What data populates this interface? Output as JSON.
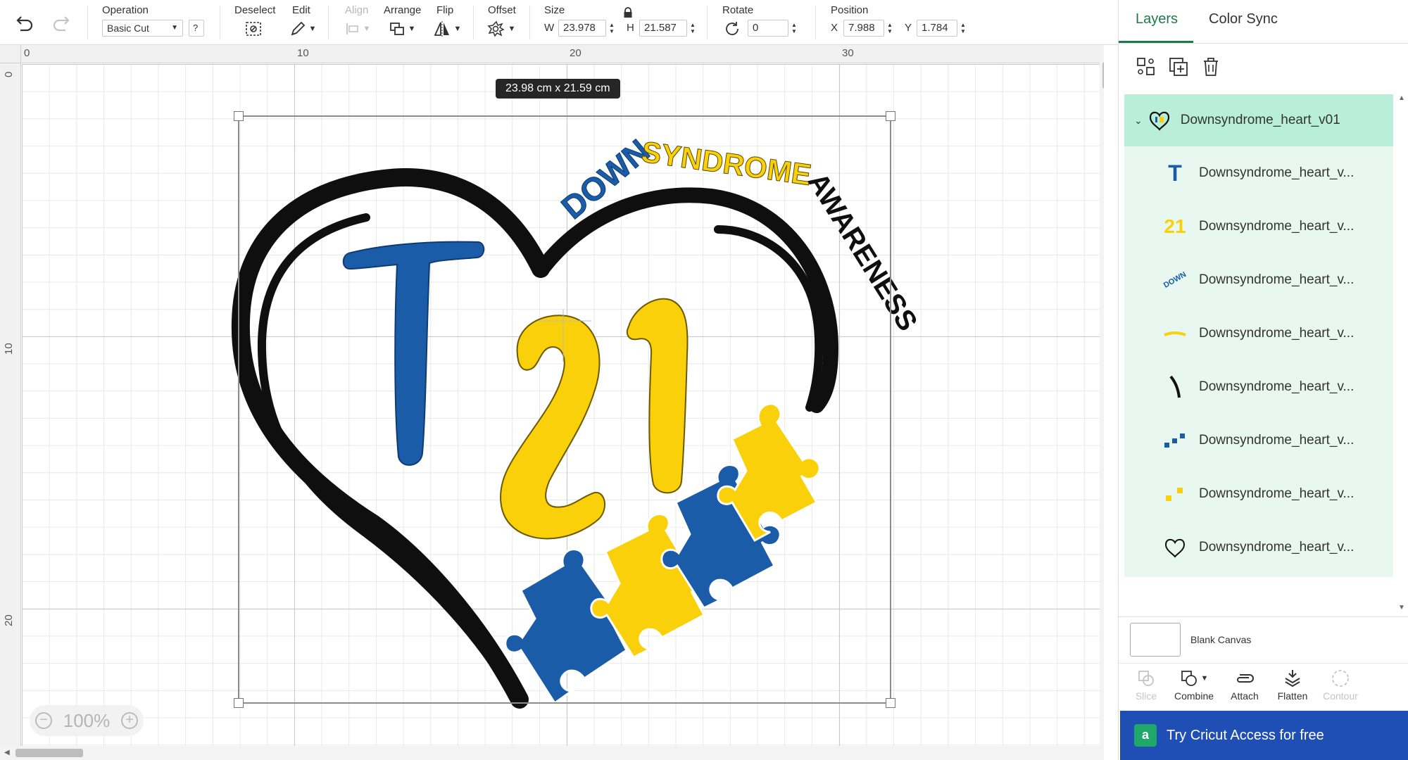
{
  "toolbar": {
    "operation_label": "Operation",
    "operation_value": "Basic Cut",
    "operation_help": "?",
    "deselect_label": "Deselect",
    "edit_label": "Edit",
    "align_label": "Align",
    "arrange_label": "Arrange",
    "flip_label": "Flip",
    "offset_label": "Offset",
    "size_label": "Size",
    "width_prefix": "W",
    "width_value": "23.978",
    "height_prefix": "H",
    "height_value": "21.587",
    "rotate_label": "Rotate",
    "rotate_value": "0",
    "position_label": "Position",
    "x_prefix": "X",
    "x_value": "7.988",
    "y_prefix": "Y",
    "y_value": "1.784"
  },
  "canvas": {
    "ruler_top": [
      "0",
      "10",
      "20",
      "30"
    ],
    "ruler_left": [
      "0",
      "10",
      "20"
    ],
    "dimension_tooltip": "23.98  cm x 21.59  cm",
    "zoom_value": "100%",
    "zoom_out": "−",
    "zoom_in": "+"
  },
  "design": {
    "word1": "DOWN",
    "word2": "SYNDROME",
    "word3": "AWARENESS",
    "letter_t": "T",
    "number_2": "2",
    "number_1": "1",
    "colors": {
      "blue": "#1a5ca8",
      "yellow": "#f9d00a",
      "black": "#0f0f0f"
    }
  },
  "panel": {
    "tabs": [
      {
        "label": "Layers",
        "active": true
      },
      {
        "label": "Color Sync",
        "active": false
      }
    ],
    "group_name": "Downsyndrome_heart_v01",
    "layers": [
      {
        "name": "Downsyndrome_heart_v...",
        "icon": "letter-t-icon"
      },
      {
        "name": "Downsyndrome_heart_v...",
        "icon": "number-21-icon"
      },
      {
        "name": "Downsyndrome_heart_v...",
        "icon": "down-text-icon"
      },
      {
        "name": "Downsyndrome_heart_v...",
        "icon": "syndrome-text-icon"
      },
      {
        "name": "Downsyndrome_heart_v...",
        "icon": "awareness-text-icon"
      },
      {
        "name": "Downsyndrome_heart_v...",
        "icon": "blue-puzzle-icon"
      },
      {
        "name": "Downsyndrome_heart_v...",
        "icon": "yellow-puzzle-icon"
      },
      {
        "name": "Downsyndrome_heart_v...",
        "icon": "heart-outline-icon"
      }
    ],
    "blank_canvas_label": "Blank Canvas",
    "bottom_tools": {
      "slice": "Slice",
      "combine": "Combine",
      "attach": "Attach",
      "flatten": "Flatten",
      "contour": "Contour"
    },
    "promo_logo": "a",
    "promo_text": "Try Cricut Access for free",
    "accent_color": "#1e7a4a",
    "promo_color": "#1f4fb5"
  }
}
